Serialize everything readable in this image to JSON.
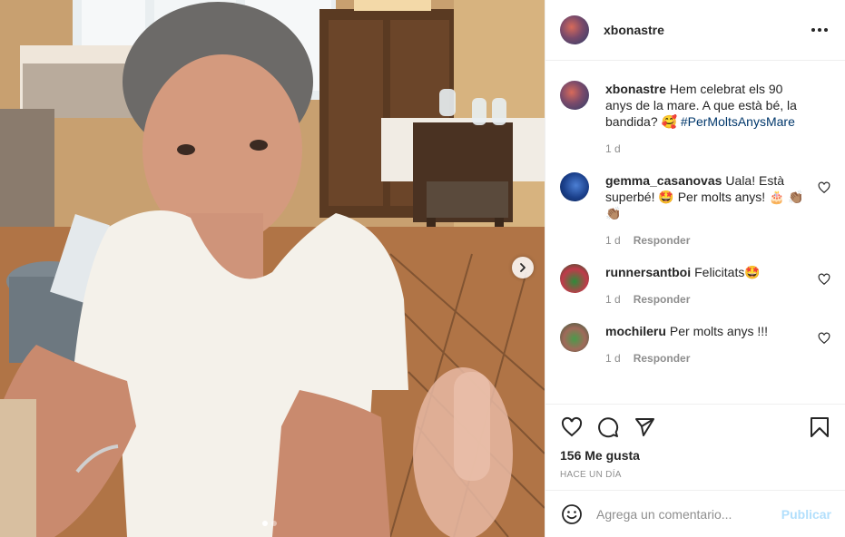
{
  "post": {
    "author": "xbonastre",
    "caption": "Hem celebrat els 90 anys de la mare. A que està bé, la bandida? 🥰",
    "hashtag": "#PerMoltsAnysMare",
    "caption_time": "1 d",
    "likes": "156 Me gusta",
    "time_ago": "HACE UN DÍA",
    "carousel": {
      "count": 2,
      "active": 0
    }
  },
  "comments": [
    {
      "user": "gemma_casanovas",
      "text": "Uala! Està superbé! 🤩 Per molts anys! 🎂 👏🏽👏🏽",
      "time": "1 d",
      "reply": "Responder"
    },
    {
      "user": "runnersantboi",
      "text": "Felicitats🤩",
      "time": "1 d",
      "reply": "Responder"
    },
    {
      "user": "mochileru",
      "text": "Per molts anys !!!",
      "time": "1 d",
      "reply": "Responder"
    }
  ],
  "add_comment": {
    "placeholder": "Agrega un comentario...",
    "publish": "Publicar"
  },
  "icons": {
    "more": "more-options-icon",
    "like": "heart-icon",
    "comment": "comment-icon",
    "share": "paper-plane-icon",
    "save": "bookmark-icon",
    "emoji": "smiley-icon",
    "next": "chevron-right-icon"
  },
  "colors": {
    "link": "#00376b",
    "muted": "#8e8e8e",
    "publish_disabled": "#b2dffc",
    "border": "#efefef"
  }
}
